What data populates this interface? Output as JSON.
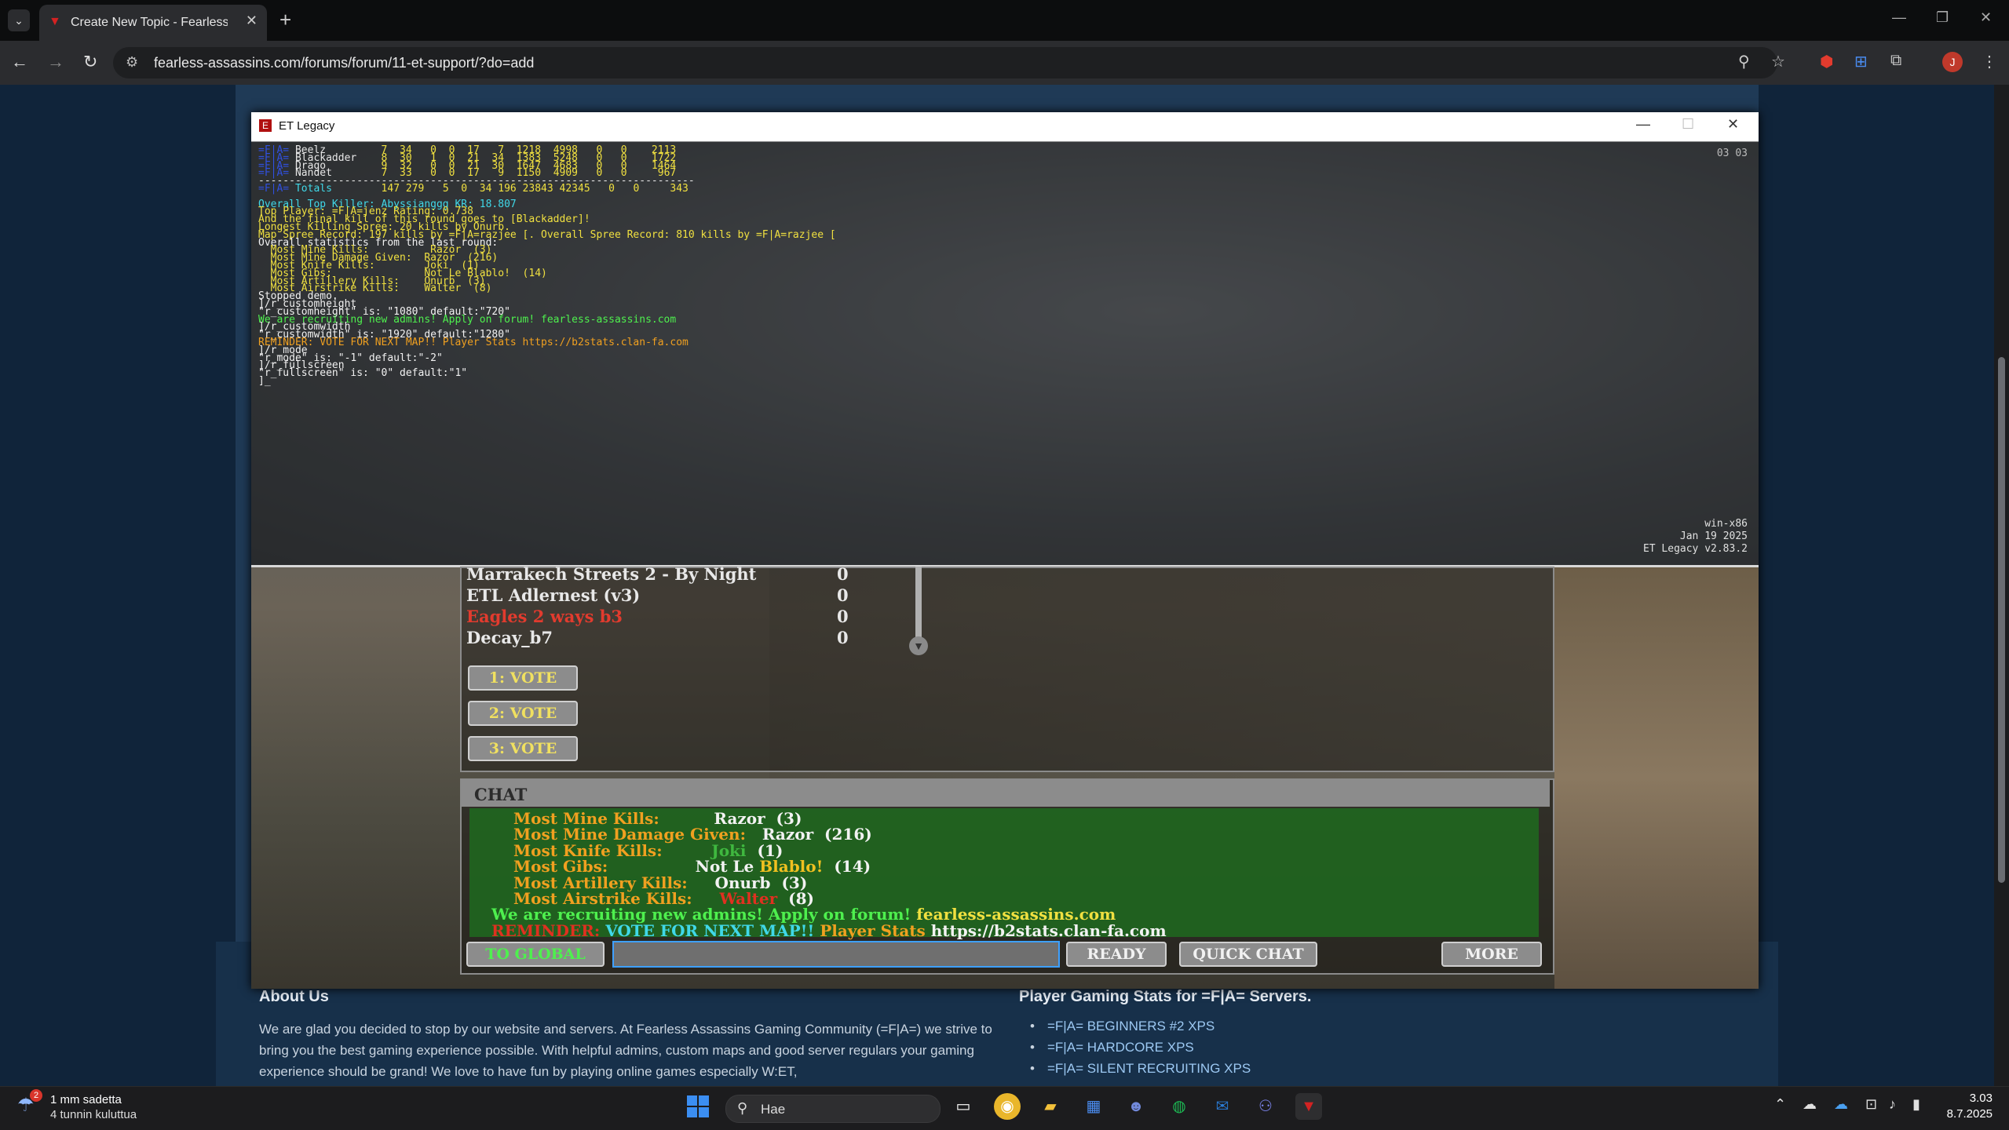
{
  "browser": {
    "tab_title": "Create New Topic - Fearless As",
    "url": "fearless-assassins.com/forums/forum/11-et-support/?do=add",
    "new_tab": "+",
    "profile_initial": "J"
  },
  "site": {
    "about_title": "About Us",
    "about_text": "We are glad you decided to stop by our website and servers. At Fearless Assassins Gaming Community (=F|A=) we strive to bring you the best gaming experience possible. With helpful admins, custom maps and good server regulars your gaming experience should be grand! We love to have fun by playing online games especially W:ET,",
    "stats_title": "Player Gaming Stats for =F|A= Servers.",
    "stats_items": [
      "=F|A= BEGINNERS #2 XPS",
      "=F|A= HARDCORE XPS",
      "=F|A= SILENT RECRUITING XPS"
    ]
  },
  "game": {
    "window_title": "ET Legacy",
    "console": {
      "time": "03 03",
      "platform": "win-x86",
      "build_date": "Jan 19 2025",
      "version": "ET Legacy v2.83.2",
      "scoreboard": [
        {
          "tag": "=F|A=",
          "name": "Beelz",
          "stats": "7  34   0  0  17   7  1218  4998   0   0    2113"
        },
        {
          "tag": "=F|A=",
          "name": "Blackadder",
          "stats": "8  30   1  0  21  34  1383  5248   0   0    1722"
        },
        {
          "tag": "=F|A=",
          "name": "Drago",
          "stats": "9  32   0  0  21  30  1647  4683   0   0    1464"
        },
        {
          "tag": "=F|A=",
          "name": "Nandet",
          "stats": "7  33   0  0  17   9  1150  4909   0   0     967"
        }
      ],
      "divider": "-----------------------------------------------------------------------",
      "totals_label": "Totals",
      "totals": "147 279   5  0  34 196 23843 42345   0   0     343",
      "lines": [
        "Overall Top Killer: Abyssianggg KR: 18.807",
        "Top Player: =F|A=jenz Rating: 0.738",
        "And the final kill of this round goes to [Blackadder]!",
        "Longest Killing Spree: 20 kills by Onurb.",
        "Map Spree Record: 197 kills by =F|A=razjee [. Overall Spree Record: 810 kills by =F|A=razjee [",
        "Overall statistics from the last round:",
        "  Most Mine Kills:          Razor  (3)",
        "  Most Mine Damage Given:  Razor  (216)",
        "  Most Knife Kills:        Joki  (1)",
        "  Most Gibs:               Not Le Blablo!  (14)",
        "  Most Artillery Kills:    Onurb  (3)",
        "  Most Airstrike Kills:    Walter  (8)",
        "Stopped demo.",
        "]/r_customheight",
        "\"r_customheight\" is: \"1080\" default:\"720\"",
        "We are recruiting new admins! Apply on forum! fearless-assassins.com",
        "]/r_customwidth",
        "\"r_customwidth\" is: \"1920\" default:\"1280\"",
        "REMINDER: VOTE FOR NEXT MAP!! Player Stats https://b2stats.clan-fa.com",
        "]/r_mode",
        "\"r_mode\" is: \"-1\" default:\"-2\"",
        "]/r_fullscreen",
        "\"r_fullscreen\" is: \"0\" default:\"1\"",
        "]_"
      ]
    },
    "maps": [
      {
        "name": "Marrakech Streets 2 - By Night",
        "votes": "0",
        "color": "#e8e8e8"
      },
      {
        "name": "ETL Adlernest (v3)",
        "votes": "0",
        "color": "#e8e8e8"
      },
      {
        "name": "Eagles 2 ways b3",
        "votes": "0",
        "color": "#e23b2e"
      },
      {
        "name": "Decay_b7",
        "votes": "0",
        "color": "#e8e8e8"
      }
    ],
    "vote_buttons": [
      "1: VOTE",
      "2: VOTE",
      "3: VOTE"
    ],
    "chat": {
      "label": "CHAT",
      "lines": [
        {
          "label": "Most Mine Kills:",
          "value": "Razor  (3)"
        },
        {
          "label": "Most Mine Damage Given:",
          "value": "Razor  (216)"
        },
        {
          "label": "Most Knife Kills:",
          "value": "Joki",
          "extra": "  (1)"
        },
        {
          "label": "Most Gibs:",
          "value": "Not Le ",
          "name2": "Blablo!",
          "extra": "  (14)"
        },
        {
          "label": "Most Artillery Kills:",
          "value": "Onurb  (3)"
        },
        {
          "label": "Most Airstrike Kills:",
          "value": "Walter",
          "extra": "  (8)"
        }
      ],
      "recruit": "We are recruiting new admins! Apply on forum!",
      "recruit_site": "fearless-assassins.com",
      "reminder_tag": "REMINDER:",
      "reminder": "VOTE FOR NEXT MAP!!",
      "reminder_stats": "Player Stats",
      "reminder_url": "https://b2stats.clan-fa.com",
      "buttons": {
        "global": "TO GLOBAL",
        "ready": "READY",
        "quick_chat": "QUICK CHAT",
        "more": "MORE"
      }
    }
  },
  "taskbar": {
    "weather_temp": "1 mm sadetta",
    "weather_desc": "4 tunnin kuluttua",
    "weather_badge": "2",
    "search_label": "Hae",
    "time": "3.03",
    "date": "8.7.2025"
  },
  "colors": {
    "chat_label": "#f0a020",
    "chat_value": "#f2f2f2",
    "knife_name": "#3fb83f",
    "red": "#e03020",
    "cyan": "#40d8e8",
    "yellow": "#f0e040",
    "green": "#4ef04e"
  }
}
